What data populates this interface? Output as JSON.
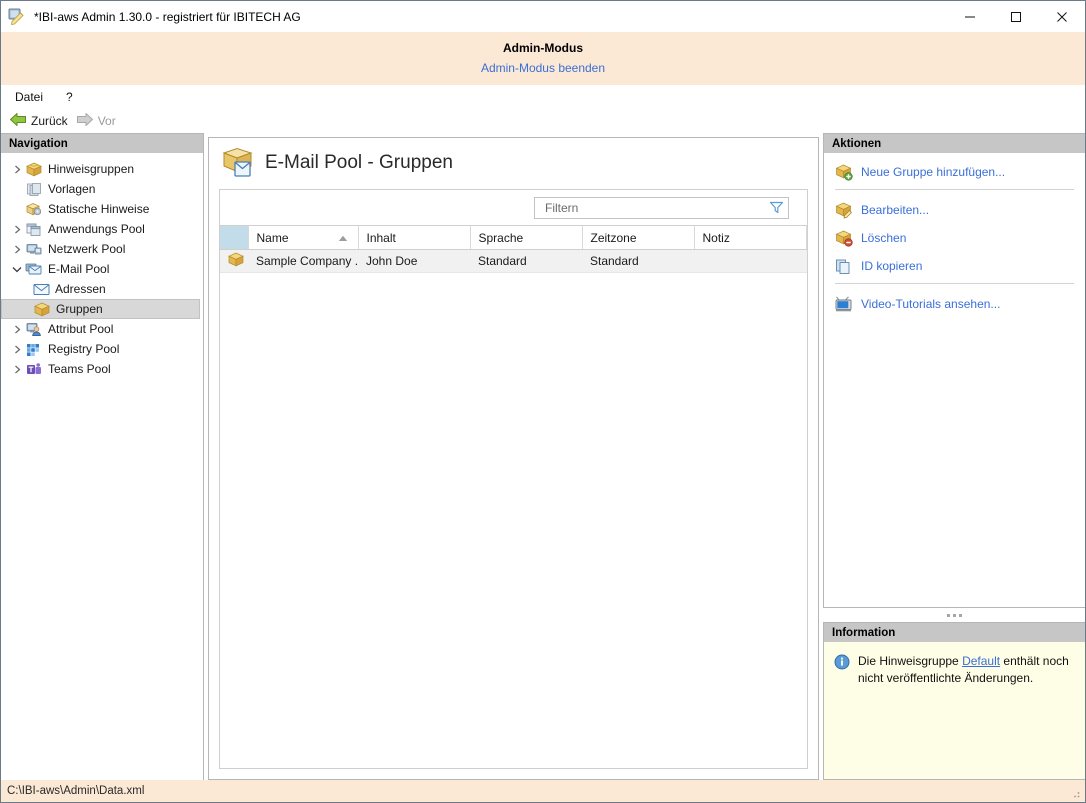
{
  "window": {
    "title": "*IBI-aws Admin 1.30.0 - registriert für IBITECH AG",
    "icon": "pen-document-icon",
    "minimize_label": "–",
    "maximize_label": "□",
    "close_label": "✕"
  },
  "admin_banner": {
    "title": "Admin-Modus",
    "exit_link": "Admin-Modus beenden"
  },
  "menubar": {
    "items": [
      {
        "label": "Datei"
      },
      {
        "label": "?"
      }
    ]
  },
  "toolbar": {
    "back_label": "Zurück",
    "forward_label": "Vor"
  },
  "navigation": {
    "header": "Navigation",
    "items": [
      {
        "label": "Hinweisgruppen",
        "icon": "box-icon",
        "twisty": "collapsed",
        "level": 1,
        "selected": false
      },
      {
        "label": "Vorlagen",
        "icon": "templates-icon",
        "twisty": "none",
        "level": 1,
        "selected": false
      },
      {
        "label": "Statische Hinweise",
        "icon": "static-box-icon",
        "twisty": "none",
        "level": 1,
        "selected": false
      },
      {
        "label": "Anwendungs Pool",
        "icon": "windows-icon",
        "twisty": "collapsed",
        "level": 1,
        "selected": false
      },
      {
        "label": "Netzwerk Pool",
        "icon": "network-icon",
        "twisty": "collapsed",
        "level": 1,
        "selected": false
      },
      {
        "label": "E-Mail Pool",
        "icon": "mailpool-icon",
        "twisty": "expanded",
        "level": 1,
        "selected": false
      },
      {
        "label": "Adressen",
        "icon": "envelope-icon",
        "twisty": "none",
        "level": 2,
        "selected": false
      },
      {
        "label": "Gruppen",
        "icon": "box-icon",
        "twisty": "none",
        "level": 2,
        "selected": true
      },
      {
        "label": "Attribut Pool",
        "icon": "user-screen-icon",
        "twisty": "collapsed",
        "level": 1,
        "selected": false
      },
      {
        "label": "Registry Pool",
        "icon": "registry-icon",
        "twisty": "collapsed",
        "level": 1,
        "selected": false
      },
      {
        "label": "Teams Pool",
        "icon": "teams-icon",
        "twisty": "collapsed",
        "level": 1,
        "selected": false
      }
    ]
  },
  "content": {
    "title": "E-Mail Pool - Gruppen",
    "icon": "mailpool-large-icon",
    "filter": {
      "placeholder": "Filtern",
      "value": "",
      "icon": "funnel-icon"
    },
    "table": {
      "columns": [
        "",
        "Name",
        "Inhalt",
        "Sprache",
        "Zeitzone",
        "Notiz"
      ],
      "sort_column": "Name",
      "sort_direction": "ascending",
      "rows": [
        {
          "icon": "box-icon",
          "name": "Sample Company ...",
          "inhalt": "John Doe",
          "sprache": "Standard",
          "zeitzone": "Standard",
          "notiz": ""
        }
      ]
    }
  },
  "actions": {
    "header": "Aktionen",
    "groups": [
      {
        "items": [
          {
            "label": "Neue Gruppe hinzufügen...",
            "icon": "box-add-icon"
          }
        ]
      },
      {
        "items": [
          {
            "label": "Bearbeiten...",
            "icon": "box-edit-icon"
          },
          {
            "label": "Löschen",
            "icon": "box-delete-icon"
          },
          {
            "label": "ID kopieren",
            "icon": "copy-icon"
          }
        ]
      },
      {
        "items": [
          {
            "label": "Video-Tutorials ansehen...",
            "icon": "tv-icon"
          }
        ]
      }
    ]
  },
  "information": {
    "header": "Information",
    "icon": "info-icon",
    "text_before": "Die Hinweisgruppe ",
    "link": "Default",
    "text_after": " enthält noch nicht veröffentlichte Änderungen."
  },
  "statusbar": {
    "path": "C:\\IBI-aws\\Admin\\Data.xml"
  },
  "colors": {
    "banner_bg": "#fbe9d5",
    "link": "#3a6fd8",
    "pane_header_bg": "#c6c6c6",
    "index_col_bg": "#c2dce9",
    "info_bg": "#fefde6",
    "selection_bg": "#d8d8d8"
  }
}
